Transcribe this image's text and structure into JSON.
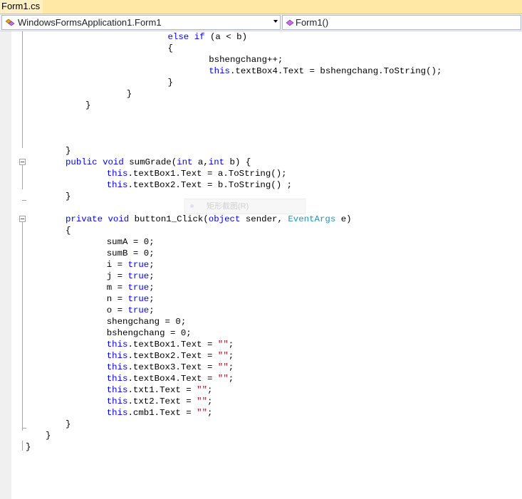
{
  "tab": {
    "title": "Form1.cs"
  },
  "nav": {
    "class_combo": "WindowsFormsApplication1.Form1",
    "member_combo": "Form1()"
  },
  "ghost_tip": "矩形截图(R)",
  "colors": {
    "keyword": "#0000ff",
    "type": "#2b91af",
    "string": "#a31515",
    "text": "#000000"
  },
  "code_lines": [
    [
      [
        "        ",
        "t"
      ],
      [
        "else",
        "kw"
      ],
      [
        " ",
        "t"
      ],
      [
        "if",
        "kw"
      ],
      [
        " (a < b)",
        "t"
      ]
    ],
    [
      [
        "        {",
        "t"
      ]
    ],
    [
      [
        "            bshengchang++;",
        "t"
      ]
    ],
    [
      [
        "            ",
        "t"
      ],
      [
        "this",
        "kw"
      ],
      [
        ".textBox4.Text = bshengchang.ToString();",
        "t"
      ]
    ],
    [
      [
        "        }",
        "t"
      ]
    ],
    [
      [
        "    }",
        "t"
      ]
    ],
    [
      [
        "}",
        "t"
      ]
    ],
    [
      [
        "",
        "t"
      ]
    ],
    [
      [
        "",
        "t"
      ]
    ],
    [
      [
        "",
        "t"
      ]
    ],
    [
      [
        "}",
        "t"
      ]
    ],
    [
      [
        "",
        "t"
      ],
      [
        "public",
        "kw"
      ],
      [
        " ",
        "t"
      ],
      [
        "void",
        "kw"
      ],
      [
        " sumGrade(",
        "t"
      ],
      [
        "int",
        "kw"
      ],
      [
        " a,",
        "t"
      ],
      [
        "int",
        "kw"
      ],
      [
        " b) {",
        "t"
      ]
    ],
    [
      [
        "    ",
        "t"
      ],
      [
        "this",
        "kw"
      ],
      [
        ".textBox1.Text = a.ToString();",
        "t"
      ]
    ],
    [
      [
        "    ",
        "t"
      ],
      [
        "this",
        "kw"
      ],
      [
        ".textBox2.Text = b.ToString() ;",
        "t"
      ]
    ],
    [
      [
        "}",
        "t"
      ]
    ],
    [
      [
        "",
        "t"
      ]
    ],
    [
      [
        "",
        "t"
      ],
      [
        "private",
        "kw"
      ],
      [
        " ",
        "t"
      ],
      [
        "void",
        "kw"
      ],
      [
        " button1_Click(",
        "t"
      ],
      [
        "object",
        "kw"
      ],
      [
        " sender, ",
        "t"
      ],
      [
        "EventArgs",
        "ty"
      ],
      [
        " e)",
        "t"
      ]
    ],
    [
      [
        "{",
        "t"
      ]
    ],
    [
      [
        "    sumA = 0;",
        "t"
      ]
    ],
    [
      [
        "    sumB = 0;",
        "t"
      ]
    ],
    [
      [
        "    i = ",
        "t"
      ],
      [
        "true",
        "kw"
      ],
      [
        ";",
        "t"
      ]
    ],
    [
      [
        "    j = ",
        "t"
      ],
      [
        "true",
        "kw"
      ],
      [
        ";",
        "t"
      ]
    ],
    [
      [
        "    m = ",
        "t"
      ],
      [
        "true",
        "kw"
      ],
      [
        ";",
        "t"
      ]
    ],
    [
      [
        "    n = ",
        "t"
      ],
      [
        "true",
        "kw"
      ],
      [
        ";",
        "t"
      ]
    ],
    [
      [
        "    o = ",
        "t"
      ],
      [
        "true",
        "kw"
      ],
      [
        ";",
        "t"
      ]
    ],
    [
      [
        "    shengchang = 0;",
        "t"
      ]
    ],
    [
      [
        "    bshengchang = 0;",
        "t"
      ]
    ],
    [
      [
        "    ",
        "t"
      ],
      [
        "this",
        "kw"
      ],
      [
        ".textBox1.Text = ",
        "t"
      ],
      [
        "\"\"",
        "str"
      ],
      [
        ";",
        "t"
      ]
    ],
    [
      [
        "    ",
        "t"
      ],
      [
        "this",
        "kw"
      ],
      [
        ".textBox2.Text = ",
        "t"
      ],
      [
        "\"\"",
        "str"
      ],
      [
        ";",
        "t"
      ]
    ],
    [
      [
        "    ",
        "t"
      ],
      [
        "this",
        "kw"
      ],
      [
        ".textBox3.Text = ",
        "t"
      ],
      [
        "\"\"",
        "str"
      ],
      [
        ";",
        "t"
      ]
    ],
    [
      [
        "    ",
        "t"
      ],
      [
        "this",
        "kw"
      ],
      [
        ".textBox4.Text = ",
        "t"
      ],
      [
        "\"\"",
        "str"
      ],
      [
        ";",
        "t"
      ]
    ],
    [
      [
        "    ",
        "t"
      ],
      [
        "this",
        "kw"
      ],
      [
        ".txt1.Text = ",
        "t"
      ],
      [
        "\"\"",
        "str"
      ],
      [
        ";",
        "t"
      ]
    ],
    [
      [
        "    ",
        "t"
      ],
      [
        "this",
        "kw"
      ],
      [
        ".txt2.Text = ",
        "t"
      ],
      [
        "\"\"",
        "str"
      ],
      [
        ";",
        "t"
      ]
    ],
    [
      [
        "    ",
        "t"
      ],
      [
        "this",
        "kw"
      ],
      [
        ".cmb1.Text = ",
        "t"
      ],
      [
        "\"\"",
        "str"
      ],
      [
        ";",
        "t"
      ]
    ],
    [
      [
        "}",
        "t"
      ]
    ],
    [
      [
        "}",
        "t"
      ]
    ],
    [
      [
        "}",
        "t"
      ]
    ]
  ]
}
